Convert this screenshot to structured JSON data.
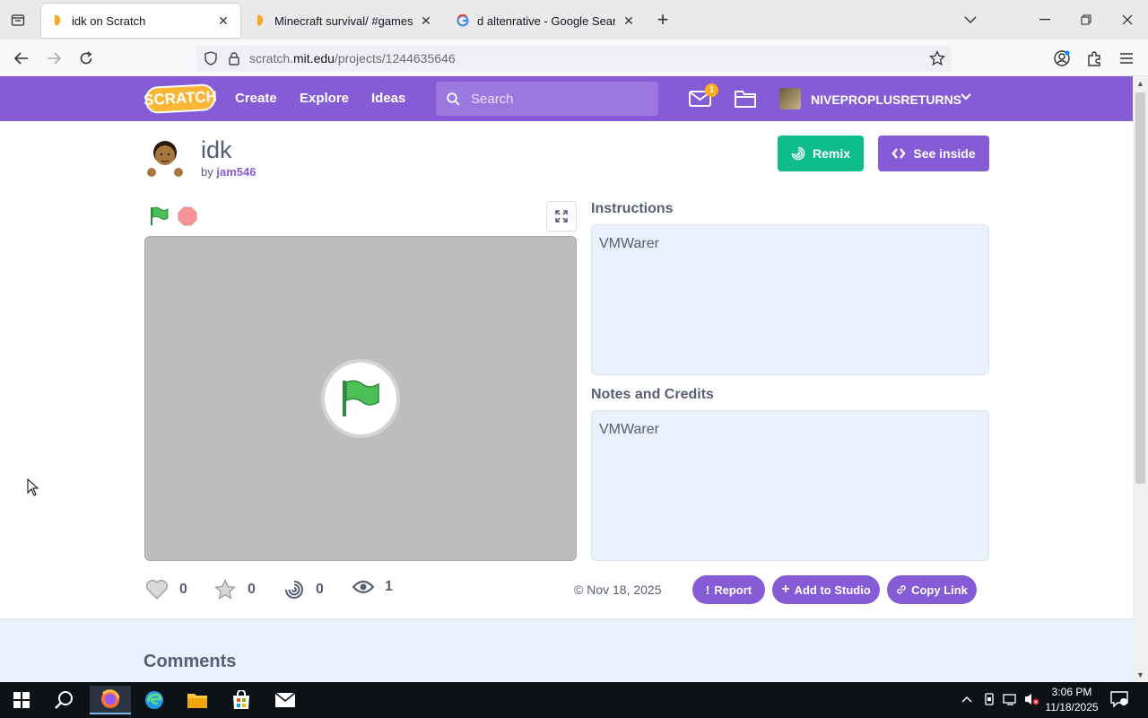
{
  "browser": {
    "tabs": [
      {
        "title": "idk on Scratch",
        "active": true
      },
      {
        "title": "Minecraft survival/ #games #tre",
        "active": false
      },
      {
        "title": "d altenrative - Google Search",
        "active": false
      }
    ],
    "url_prefix": "scratch.",
    "url_domain": "mit.edu",
    "url_path": "/projects/1244635646"
  },
  "scratch_nav": {
    "logo": "SCRATCH",
    "create": "Create",
    "explore": "Explore",
    "ideas": "Ideas",
    "search_placeholder": "Search",
    "message_count": "1",
    "username": "NIVEPROPLUSRETURNS"
  },
  "project": {
    "title": "idk",
    "by_label": "by",
    "author": "jam546",
    "remix_label": "Remix",
    "see_inside_label": "See inside",
    "instructions_heading": "Instructions",
    "instructions_text": "VMWarer",
    "notes_heading": "Notes and Credits",
    "notes_text": "VMWarer",
    "stats": {
      "loves": "0",
      "favorites": "0",
      "remixes": "0",
      "views": "1"
    },
    "date": "Nov 18, 2025",
    "report_label": "Report",
    "add_to_studio_label": "Add to Studio",
    "copy_link_label": "Copy Link",
    "comments_heading": "Comments"
  },
  "taskbar": {
    "time": "3:06 PM",
    "date": "11/18/2025"
  },
  "colors": {
    "scratch_purple": "#855cd6",
    "remix_green": "#0fbd8c",
    "text_gray": "#575e75"
  }
}
